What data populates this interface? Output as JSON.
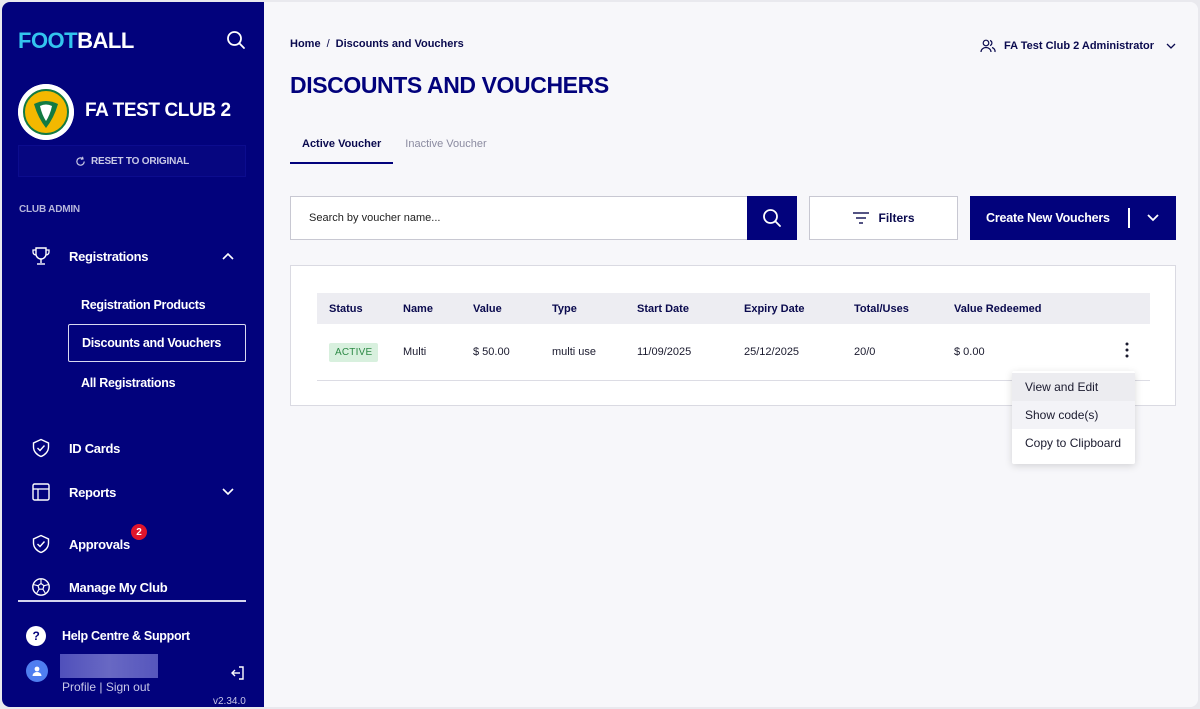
{
  "sidebar": {
    "logo_part1": "FOOT",
    "logo_part2": "BALL",
    "club_name": "FA TEST CLUB 2",
    "reset_label": "RESET TO ORIGINAL",
    "section_label": "CLUB ADMIN",
    "nav": {
      "registrations": "Registrations",
      "id_cards": "ID Cards",
      "reports": "Reports",
      "approvals": "Approvals",
      "approvals_badge": "2",
      "manage_club": "Manage My Club"
    },
    "sub_items": [
      "Registration Products",
      "Discounts and Vouchers",
      "All Registrations"
    ],
    "help": "Help Centre & Support",
    "profile": "Profile",
    "sign_out": "Sign out",
    "version": "v2.34.0"
  },
  "header": {
    "breadcrumb": [
      "Home",
      "/",
      "Discounts and Vouchers"
    ],
    "user": "FA Test Club 2 Administrator",
    "title": "DISCOUNTS AND VOUCHERS"
  },
  "tabs": [
    "Active Voucher",
    "Inactive Voucher"
  ],
  "toolbar": {
    "search_placeholder": "Search by voucher name...",
    "filters_label": "Filters",
    "create_label": "Create New Vouchers"
  },
  "table": {
    "columns": [
      "Status",
      "Name",
      "Value",
      "Type",
      "Start Date",
      "Expiry Date",
      "Total/Uses",
      "Value Redeemed"
    ],
    "rows": [
      {
        "status": "ACTIVE",
        "name": "Multi",
        "value": "$ 50.00",
        "type": "multi use",
        "start": "11/09/2025",
        "expiry": "25/12/2025",
        "uses": "20/0",
        "redeemed": "$ 0.00"
      }
    ]
  },
  "context_menu": [
    "View and Edit",
    "Show code(s)",
    "Copy to Clipboard"
  ],
  "colors": {
    "brand": "#02027c",
    "accent": "#33c4ee",
    "active_bg": "#d8f0de",
    "active_text": "#2d8a46",
    "badge": "#e0142c"
  }
}
